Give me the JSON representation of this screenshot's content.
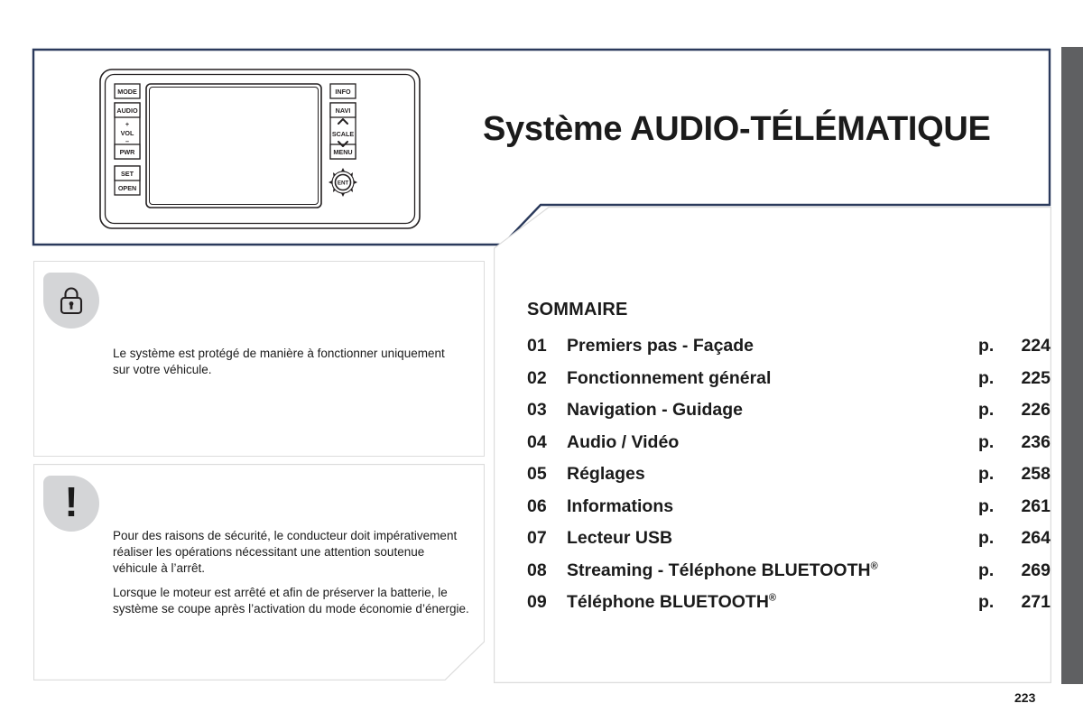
{
  "page": {
    "title": "Système AUDIO-TÉLÉMATIQUE",
    "folio": "223",
    "accent_color": "#2b3a5c",
    "badge_color": "#d4d5d7",
    "edge_tab_color": "#5f6062",
    "panel_border_color": "#dcdcdc"
  },
  "device": {
    "name": "audio-telematic-head-unit",
    "left_buttons": [
      {
        "label": "MODE"
      },
      {
        "label": "AUDIO"
      },
      {
        "label": "+"
      },
      {
        "label": "VOL"
      },
      {
        "label": "–"
      },
      {
        "label": "PWR"
      },
      {
        "label": "SET"
      },
      {
        "label": "OPEN"
      }
    ],
    "right_buttons": [
      {
        "label": "INFO"
      },
      {
        "label": "NAVI"
      },
      {
        "label": "SCALE"
      },
      {
        "label": "MENU"
      }
    ],
    "knob_label": "ENT"
  },
  "notes": [
    {
      "icon": "lock-icon",
      "lines": [
        "Le système est protégé de manière à fonctionner uniquement sur votre véhicule."
      ]
    },
    {
      "icon": "warning-exclamation-icon",
      "icon_glyph": "!",
      "lines": [
        "Pour des raisons de sécurité, le conducteur doit impérativement réaliser les opérations nécessitant une attention soutenue véhicule à l’arrêt.",
        "Lorsque le moteur est arrêté et afin de préserver la batterie, le système se coupe après l’activation du mode économie d’énergie."
      ]
    }
  ],
  "sommaire": {
    "heading": "SOMMAIRE",
    "page_prefix": "p.",
    "entries": [
      {
        "num": "01",
        "label": "Premiers pas - Façade",
        "page": "224",
        "reg": false
      },
      {
        "num": "02",
        "label": "Fonctionnement général",
        "page": "225",
        "reg": false
      },
      {
        "num": "03",
        "label": "Navigation - Guidage",
        "page": "226",
        "reg": false
      },
      {
        "num": "04",
        "label": "Audio / Vidéo",
        "page": "236",
        "reg": false
      },
      {
        "num": "05",
        "label": "Réglages",
        "page": "258",
        "reg": false
      },
      {
        "num": "06",
        "label": "Informations",
        "page": "261",
        "reg": false
      },
      {
        "num": "07",
        "label": "Lecteur USB",
        "page": "264",
        "reg": false
      },
      {
        "num": "08",
        "label": "Streaming - Téléphone BLUETOOTH",
        "page": "269",
        "reg": true
      },
      {
        "num": "09",
        "label": "Téléphone BLUETOOTH",
        "page": "271",
        "reg": true
      }
    ]
  }
}
